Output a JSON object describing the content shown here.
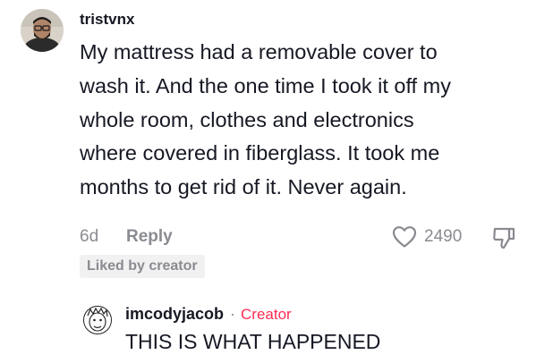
{
  "comment": {
    "username": "tristvnx",
    "text": "My mattress had a removable cover to wash it. And the one time I took it off my whole room, clothes and electronics where covered in fiberglass. It took me months to get rid of it. Never again.",
    "time": "6d",
    "reply_label": "Reply",
    "like_count": "2490",
    "liked_badge": "Liked by creator",
    "icons": {
      "like": "heart-outline-icon",
      "dislike": "thumbs-down-icon"
    }
  },
  "reply": {
    "username": "imcodyjacob",
    "separator": "·",
    "tag": "Creator",
    "text": "THIS IS WHAT HAPPENED"
  },
  "colors": {
    "text": "#161823",
    "muted": "#8a8b91",
    "creator": "#fe2c55",
    "badge_bg": "#f1f1f2"
  }
}
